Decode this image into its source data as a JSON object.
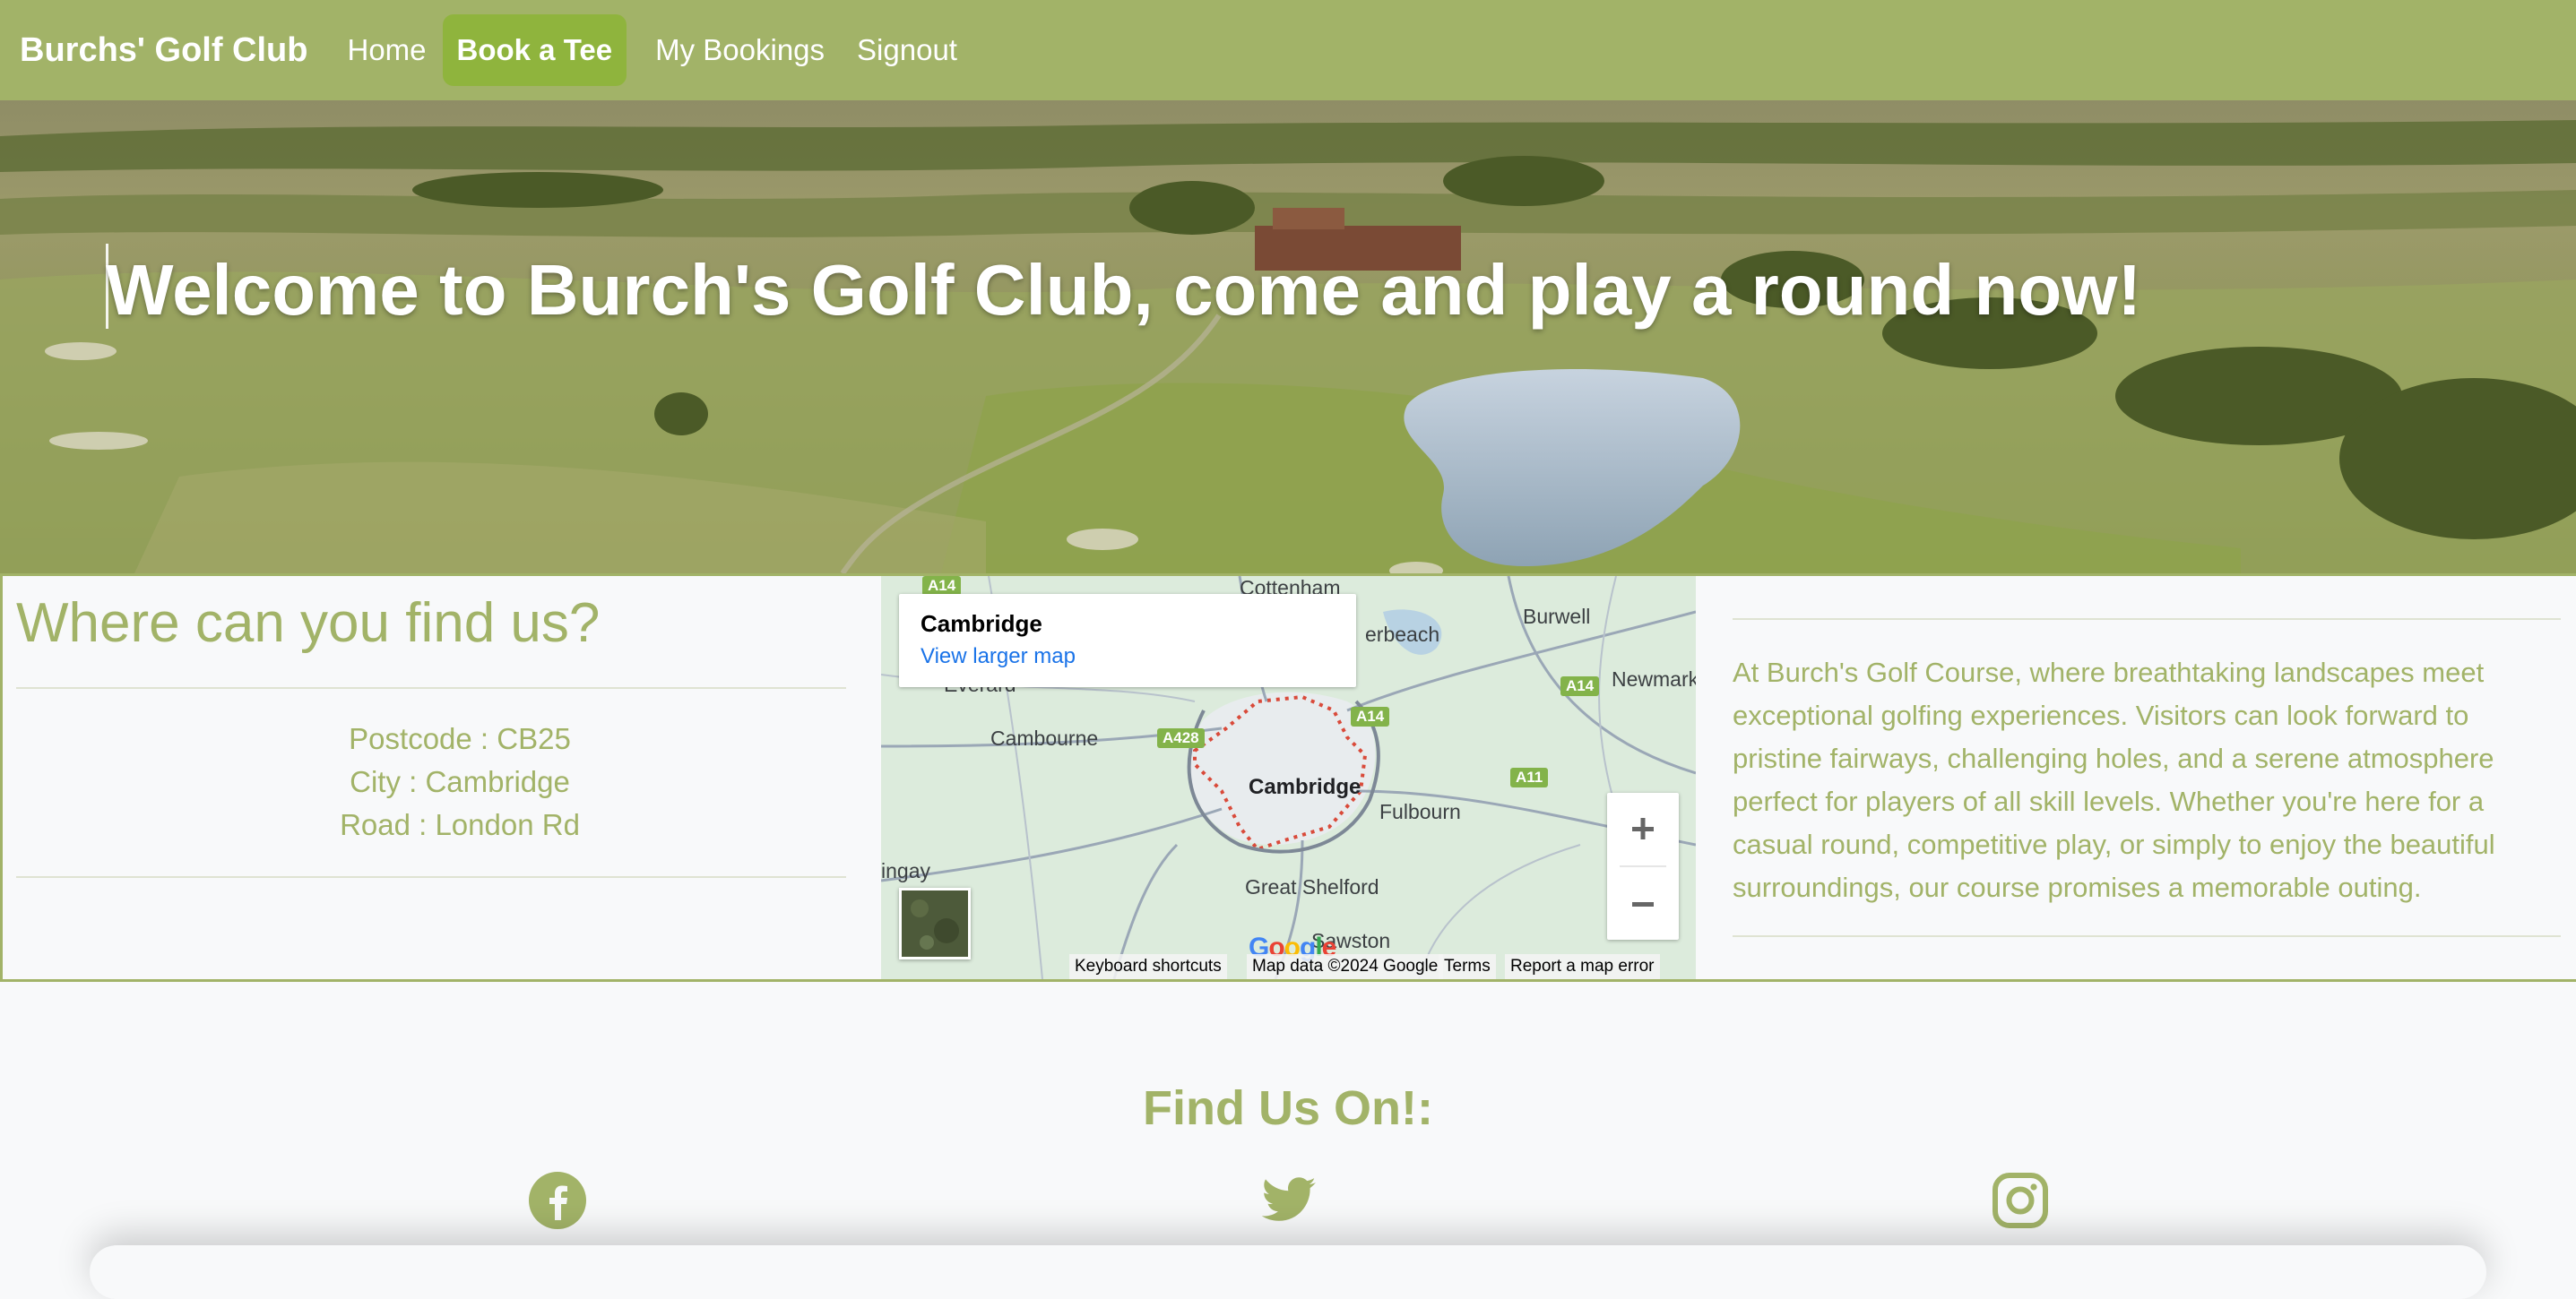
{
  "nav": {
    "brand": "Burchs' Golf Club",
    "links": [
      "Home",
      "Book a Tee",
      "My Bookings",
      "Signout"
    ]
  },
  "hero": {
    "title": "Welcome to Burch's Golf Club, come and play a round now!"
  },
  "location": {
    "title": "Where can you find us?",
    "postcode": "Postcode : CB25",
    "city": "City : Cambridge",
    "road": "Road : London Rd"
  },
  "map": {
    "place_title": "Cambridge",
    "larger_map_link": "View larger map",
    "labels": [
      "Cottenham",
      "erbeach",
      "Burwell",
      "Newmark",
      "Everard",
      "Cambourne",
      "Cambridge",
      "Fulbourn",
      "ingay",
      "Great Shelford",
      "Sawston"
    ],
    "road_badges": [
      "A14",
      "A14",
      "A14",
      "A428",
      "A11"
    ],
    "attribution": [
      "Keyboard shortcuts",
      "Map data ©2024 Google",
      "Terms",
      "Report a map error"
    ],
    "logo_text": "Google"
  },
  "about": {
    "text": "At Burch's Golf Course, where breathtaking landscapes meet exceptional golfing experiences. Visitors can look forward to pristine fairways, challenging holes, and a serene atmosphere perfect for players of all skill levels. Whether you're here for a casual round, competitive play, or simply to enjoy the beautiful surroundings, our course promises a memorable outing."
  },
  "footer": {
    "title": "Find Us On!:",
    "icons": [
      "facebook-icon",
      "twitter-icon",
      "instagram-icon"
    ]
  },
  "colors": {
    "brand_green": "#a2b368",
    "active_green": "#8fb43d",
    "map_link": "#1a73e8"
  }
}
